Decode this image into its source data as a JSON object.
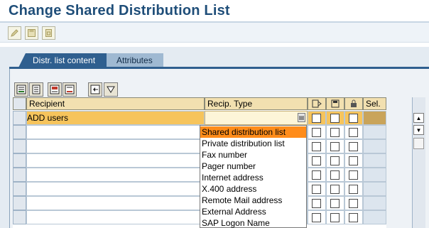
{
  "page": {
    "title": "Change Shared Distribution List"
  },
  "toolbar": {
    "buttons": [
      {
        "name": "display-change-button",
        "icon": "pencil-glasses-icon"
      },
      {
        "name": "save-button",
        "icon": "disk-icon"
      },
      {
        "name": "other-object-button",
        "icon": "doc-icon"
      }
    ]
  },
  "tabs": [
    {
      "label": "Distr. list content",
      "active": true
    },
    {
      "label": "Attributes",
      "active": false
    }
  ],
  "grid_toolbar": {
    "buttons": [
      {
        "name": "insert-row-button",
        "icon": "insert-rows-icon"
      },
      {
        "name": "details-button",
        "icon": "details-icon"
      },
      {
        "name": "print-button",
        "icon": "print-icon"
      },
      {
        "name": "delete-row-button",
        "icon": "delete-row-icon"
      },
      {
        "name": "select-all-button",
        "icon": "select-all-icon"
      },
      {
        "name": "filter-button",
        "icon": "filter-icon"
      }
    ]
  },
  "grid": {
    "columns": [
      "Recipient",
      "Recip. Type",
      "express-icon",
      "copy-icon",
      "lock-icon",
      "Sel."
    ],
    "sel_label": "Sel.",
    "rows": [
      {
        "recipient": "ADD users",
        "recip_type": ""
      }
    ]
  },
  "recip_type_dropdown": {
    "selected": "Shared distribution list",
    "options": [
      "Shared distribution list",
      "Private distribution list",
      "Fax number",
      "Pager number",
      "Internet address",
      "X.400 address",
      "Remote Mail address",
      "External Address",
      "SAP Logon Name"
    ]
  },
  "colors": {
    "title": "#1f4e79",
    "tab_active": "#2f5f8f",
    "header": "#f2e0b0",
    "active_row": "#f6c45c",
    "dropdown_selected": "#ff8c1a"
  }
}
